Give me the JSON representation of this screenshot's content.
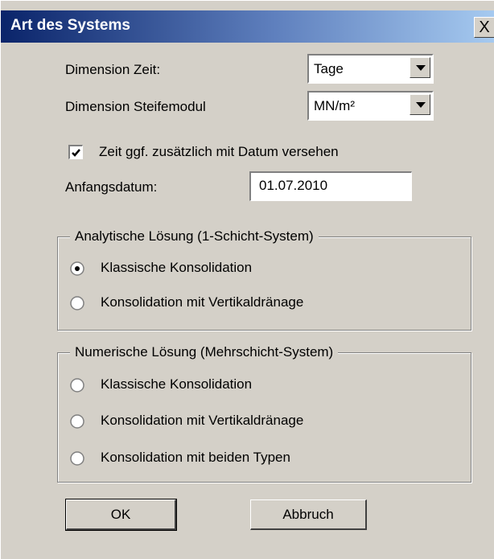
{
  "window": {
    "title": "Art des Systems",
    "close_label": "X"
  },
  "dimensions": {
    "zeit_label": "Dimension Zeit:",
    "zeit_value": "Tage",
    "steife_label": "Dimension Steifemodul",
    "steife_value": "MN/m²"
  },
  "datum": {
    "checkbox_label": "Zeit ggf. zusätzlich mit Datum versehen",
    "checkbox_checked": true,
    "anfang_label": "Anfangsdatum:",
    "anfang_value": "01.07.2010"
  },
  "analytisch": {
    "title": "Analytische Lösung (1-Schicht-System)",
    "options": [
      {
        "label": "Klassische Konsolidation",
        "selected": true
      },
      {
        "label": "Konsolidation mit Vertikaldränage",
        "selected": false
      }
    ]
  },
  "numerisch": {
    "title": "Numerische Lösung (Mehrschicht-System)",
    "options": [
      {
        "label": "Klassische Konsolidation",
        "selected": false
      },
      {
        "label": "Konsolidation mit Vertikaldränage",
        "selected": false
      },
      {
        "label": "Konsolidation mit beiden Typen",
        "selected": false
      }
    ]
  },
  "buttons": {
    "ok": "OK",
    "cancel": "Abbruch"
  },
  "colors": {
    "face": "#d4d0c8",
    "title_start": "#0a246a",
    "title_end": "#a6caf0"
  }
}
